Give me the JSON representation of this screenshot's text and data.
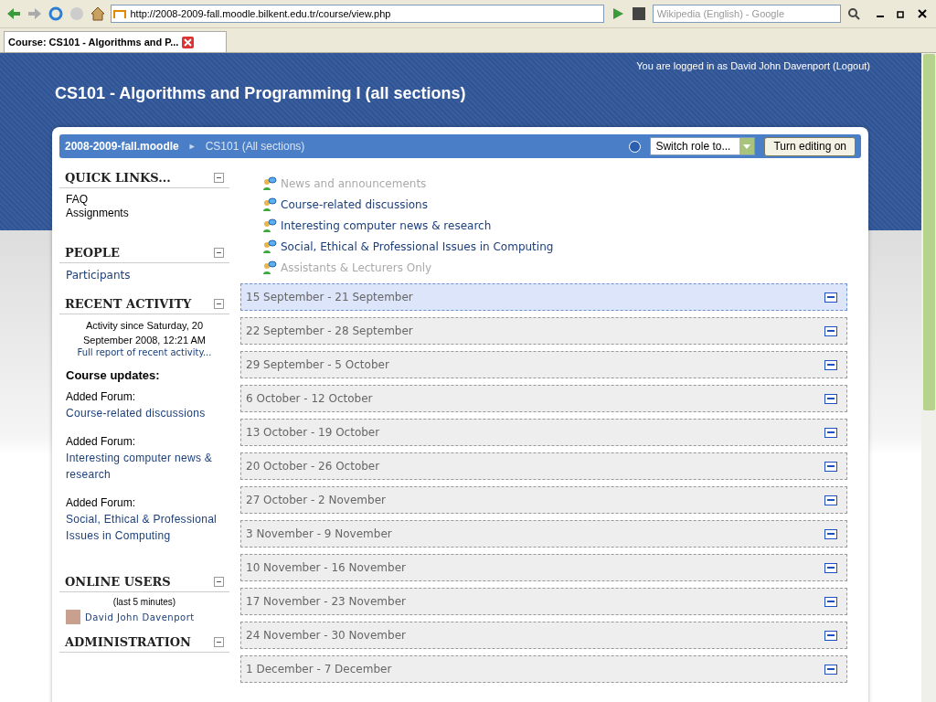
{
  "browser": {
    "address": "http://2008-2009-fall.moodle.bilkent.edu.tr/course/view.php",
    "search_placeholder": "Wikipedia (English) - Google",
    "tab_title": "Course: CS101 - Algorithms and P..."
  },
  "header": {
    "login_text": "You are logged in as David John Davenport",
    "logout": "(Logout)",
    "title": "CS101 - Algorithms and Programming I (all sections)"
  },
  "navbar": {
    "site": "2008-2009-fall.moodle",
    "separator": "►",
    "course": "CS101 (All sections)",
    "switch_role": "Switch role to...",
    "editing_button": "Turn editing on"
  },
  "sidebar": {
    "quick_links": {
      "title": "QUICK LINKS...",
      "items": [
        "FAQ",
        "Assignments"
      ]
    },
    "people": {
      "title": "PEOPLE",
      "items": [
        "Participants"
      ]
    },
    "recent_activity": {
      "title": "RECENT ACTIVITY",
      "since": "Activity since Saturday, 20 September 2008, 12:21 AM",
      "full_report": "Full report of recent activity...",
      "updates_heading": "Course updates:",
      "updates": [
        {
          "label": "Added Forum:",
          "link": "Course-related discussions"
        },
        {
          "label": "Added Forum:",
          "link": "Interesting computer news & research"
        },
        {
          "label": "Added Forum:",
          "link": "Social, Ethical & Professional Issues in Computing"
        }
      ]
    },
    "online_users": {
      "title": "ONLINE USERS",
      "period": "(last 5 minutes)",
      "users": [
        "David John Davenport"
      ]
    },
    "administration": {
      "title": "ADMINISTRATION"
    }
  },
  "forums": [
    {
      "name": "News and announcements",
      "hidden": true
    },
    {
      "name": "Course-related discussions",
      "hidden": false
    },
    {
      "name": "Interesting computer news & research",
      "hidden": false
    },
    {
      "name": "Social, Ethical & Professional Issues in Computing",
      "hidden": false
    },
    {
      "name": "Assistants & Lecturers Only",
      "hidden": true
    }
  ],
  "weeks": [
    {
      "title": "15 September - 21 September",
      "current": true
    },
    {
      "title": "22 September - 28 September",
      "current": false
    },
    {
      "title": "29 September - 5 October",
      "current": false
    },
    {
      "title": "6 October - 12 October",
      "current": false
    },
    {
      "title": "13 October - 19 October",
      "current": false
    },
    {
      "title": "20 October - 26 October",
      "current": false
    },
    {
      "title": "27 October - 2 November",
      "current": false
    },
    {
      "title": "3 November - 9 November",
      "current": false
    },
    {
      "title": "10 November - 16 November",
      "current": false
    },
    {
      "title": "17 November - 23 November",
      "current": false
    },
    {
      "title": "24 November - 30 November",
      "current": false
    },
    {
      "title": "1 December - 7 December",
      "current": false
    }
  ]
}
